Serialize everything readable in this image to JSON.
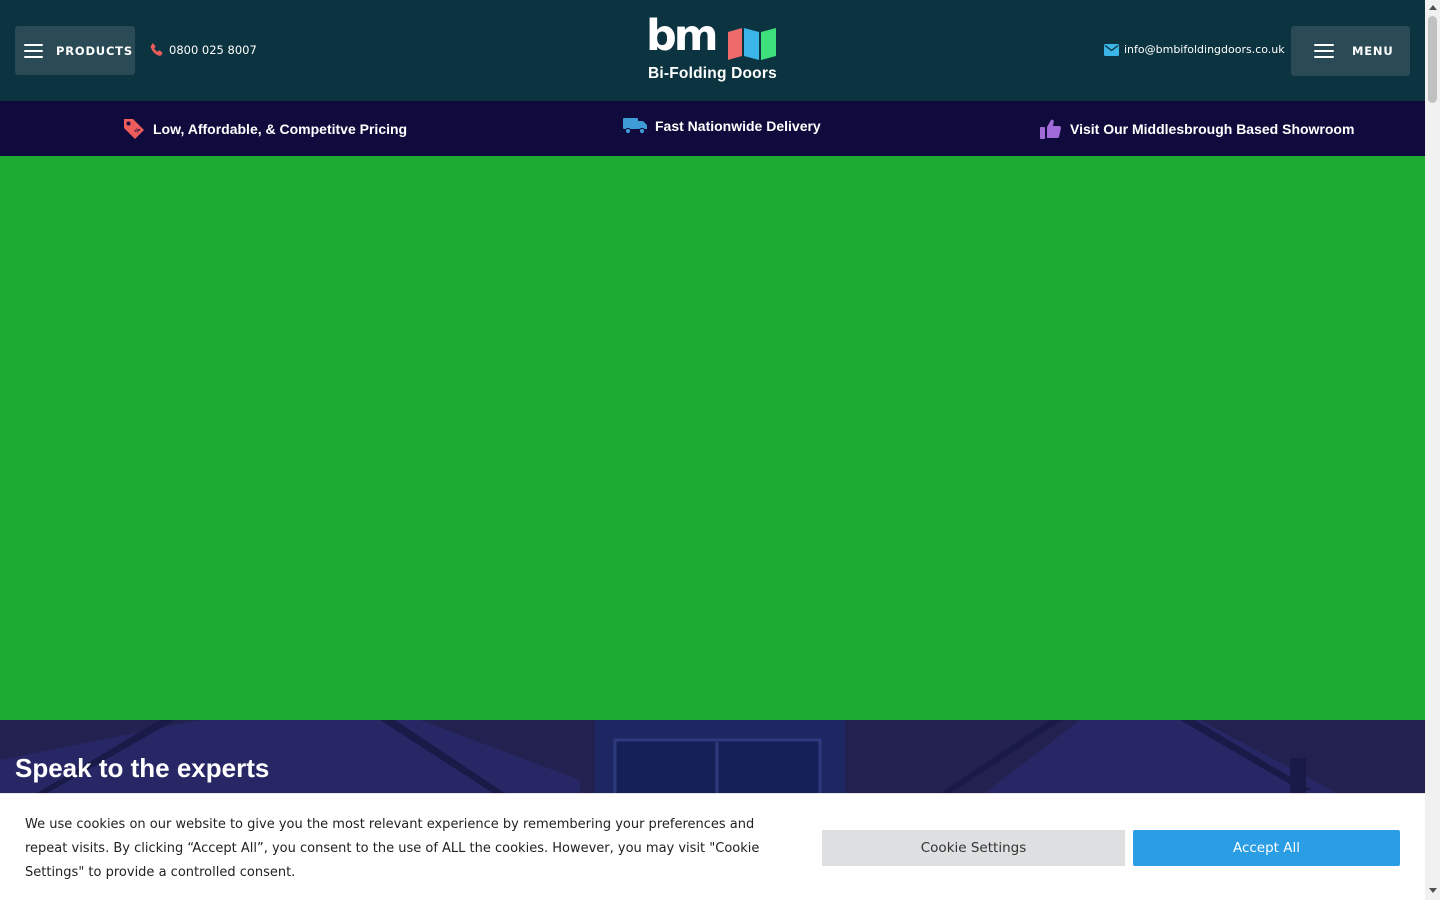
{
  "header": {
    "products_label": "PRODUCTS",
    "phone": "0800 025 8007",
    "logo_text": "bm",
    "logo_subtitle": "Bi-Folding Doors",
    "email": "info@bmbifoldingdoors.co.uk",
    "menu_label": "MENU"
  },
  "usp_bar": {
    "items": [
      {
        "label": "Low, Affordable, & Competitve Pricing",
        "icon": "price-tag-icon",
        "icon_color": "#ef5c5c"
      },
      {
        "label": "Fast Nationwide Delivery",
        "icon": "delivery-truck-icon",
        "icon_color": "#3e9bd6"
      },
      {
        "label": "Visit Our Middlesbrough Based Showroom",
        "icon": "thumbs-up-icon",
        "icon_color": "#a06ad8"
      }
    ]
  },
  "experts": {
    "title": "Speak to the experts"
  },
  "cookie_banner": {
    "text": "We use cookies on our website to give you the most relevant experience by remembering your preferences and repeat visits. By clicking “Accept All”, you consent to the use of ALL the cookies. However, you may visit \"Cookie Settings\" to provide a controlled consent.",
    "settings_label": "Cookie Settings",
    "accept_label": "Accept All"
  },
  "colors": {
    "header_bg": "#0c3440",
    "usp_bg": "#0f0b3c",
    "hero_bg": "#1eab33",
    "experts_bg": "#232150",
    "accept_bg": "#2a9de4",
    "phone_icon": "#ef5c5c",
    "email_icon": "#3bb4e8"
  }
}
